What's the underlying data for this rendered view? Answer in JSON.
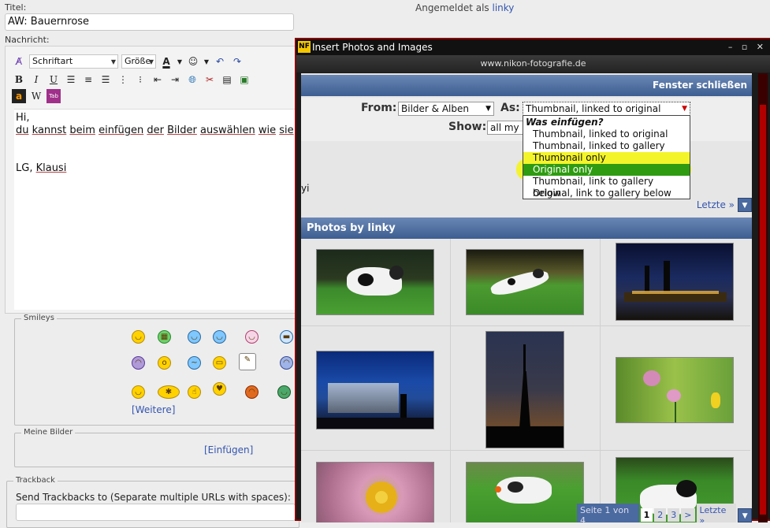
{
  "form": {
    "title_label": "Titel:",
    "title_value": "AW: Bauernrose",
    "logged_in_prefix": "Angemeldet als",
    "logged_in_user": "linky",
    "message_label": "Nachricht:"
  },
  "toolbar": {
    "font_select": "Schriftart",
    "size_select": "Größe"
  },
  "editor": {
    "lines": [
      "Hi,",
      "du kannst beim einfügen der Bilder auswählen wie sie",
      "",
      "",
      "LG, Klausi"
    ]
  },
  "smileys": {
    "legend": "Smileys",
    "more_link": "[Weitere]"
  },
  "my_images": {
    "legend": "Meine Bilder",
    "insert_link": "[Einfügen]"
  },
  "trackback": {
    "legend": "Trackback",
    "label": "Send Trackbacks to (Separate multiple URLs with spaces):"
  },
  "popup": {
    "logo": "NF",
    "title": "Insert Photos and Images",
    "window_controls": "– ▫ ✕",
    "domain": "www.nikon-fotografie.de",
    "close_label": "Fenster schließen",
    "from_label": "From:",
    "from_value": "Bilder & Alben",
    "as_label": "As:",
    "as_value": "Thumbnail, linked to original",
    "show_label": "Show:",
    "show_value": "all my",
    "typed_text": "yi",
    "last_top": "Letzte »",
    "photos_header": "Photos by linky",
    "dropdown": {
      "header": "Was einfügen?",
      "options": [
        "Thumbnail, linked to original",
        "Thumbnail, linked to gallery",
        "Thumbnail only",
        "Original only",
        "Thumbnail, link to gallery below",
        "Original, link to gallery below"
      ]
    },
    "pager": {
      "label": "Seite 1 von 4",
      "pages": [
        "1",
        "2",
        "3",
        ">"
      ],
      "last": "Letzte »"
    }
  }
}
